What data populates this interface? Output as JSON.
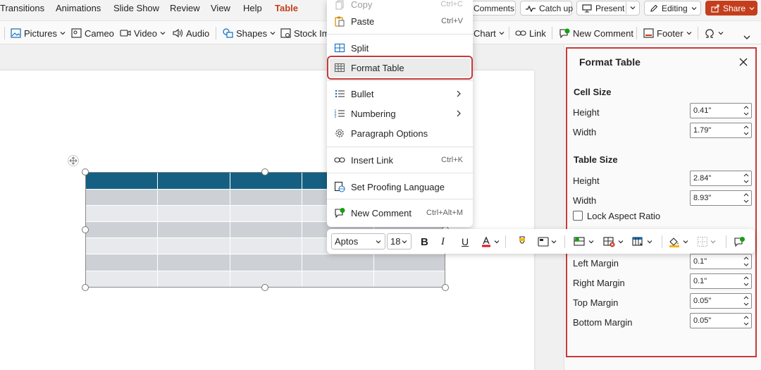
{
  "ribbon": {
    "tabs": [
      {
        "label": "Transitions",
        "active": false
      },
      {
        "label": "Animations",
        "active": false
      },
      {
        "label": "Slide Show",
        "active": false
      },
      {
        "label": "Review",
        "active": false
      },
      {
        "label": "View",
        "active": false
      },
      {
        "label": "Help",
        "active": false
      },
      {
        "label": "Table",
        "active": true
      }
    ],
    "actions": {
      "comments": "Comments",
      "catch_up": "Catch up",
      "present": "Present",
      "editing": "Editing",
      "share": "Share"
    },
    "toolbar": {
      "pictures": "Pictures",
      "cameo": "Cameo",
      "video": "Video",
      "audio": "Audio",
      "shapes": "Shapes",
      "stock_images": "Stock Im",
      "chart": "Chart",
      "link": "Link",
      "new_comment": "New Comment",
      "footer": "Footer"
    }
  },
  "context_menu": {
    "copy": {
      "label": "Copy",
      "shortcut": "Ctrl+C"
    },
    "paste": {
      "label": "Paste",
      "shortcut": "Ctrl+V"
    },
    "split": {
      "label": "Split"
    },
    "format_table": {
      "label": "Format Table"
    },
    "bullet": {
      "label": "Bullet"
    },
    "numbering": {
      "label": "Numbering"
    },
    "paragraph_options": {
      "label": "Paragraph Options"
    },
    "insert_link": {
      "label": "Insert Link",
      "shortcut": "Ctrl+K"
    },
    "set_proofing_language": {
      "label": "Set Proofing Language"
    },
    "new_comment": {
      "label": "New Comment",
      "shortcut": "Ctrl+Alt+M"
    }
  },
  "mini_toolbar": {
    "font": "Aptos",
    "size": "18",
    "bold": "B",
    "italic": "I",
    "underline": "U"
  },
  "format_pane": {
    "title": "Format Table",
    "cell_size": {
      "heading": "Cell Size",
      "height_label": "Height",
      "height": "0.41\"",
      "width_label": "Width",
      "width": "1.79\""
    },
    "table_size": {
      "heading": "Table Size",
      "height_label": "Height",
      "height": "2.84\"",
      "width_label": "Width",
      "width": "8.93\"",
      "lock_aspect": "Lock Aspect Ratio"
    },
    "margins": {
      "left_label": "Left Margin",
      "left": "0.1\"",
      "right_label": "Right Margin",
      "right": "0.1\"",
      "top_label": "Top Margin",
      "top": "0.05\"",
      "bottom_label": "Bottom Margin",
      "bottom": "0.05\""
    }
  },
  "colors": {
    "accent": "#c43e1c",
    "table_header": "#156082",
    "table_band_dark": "#cdd1d6",
    "table_band_light": "#e7e9ec",
    "highlight_frame": "#c53a3a"
  }
}
